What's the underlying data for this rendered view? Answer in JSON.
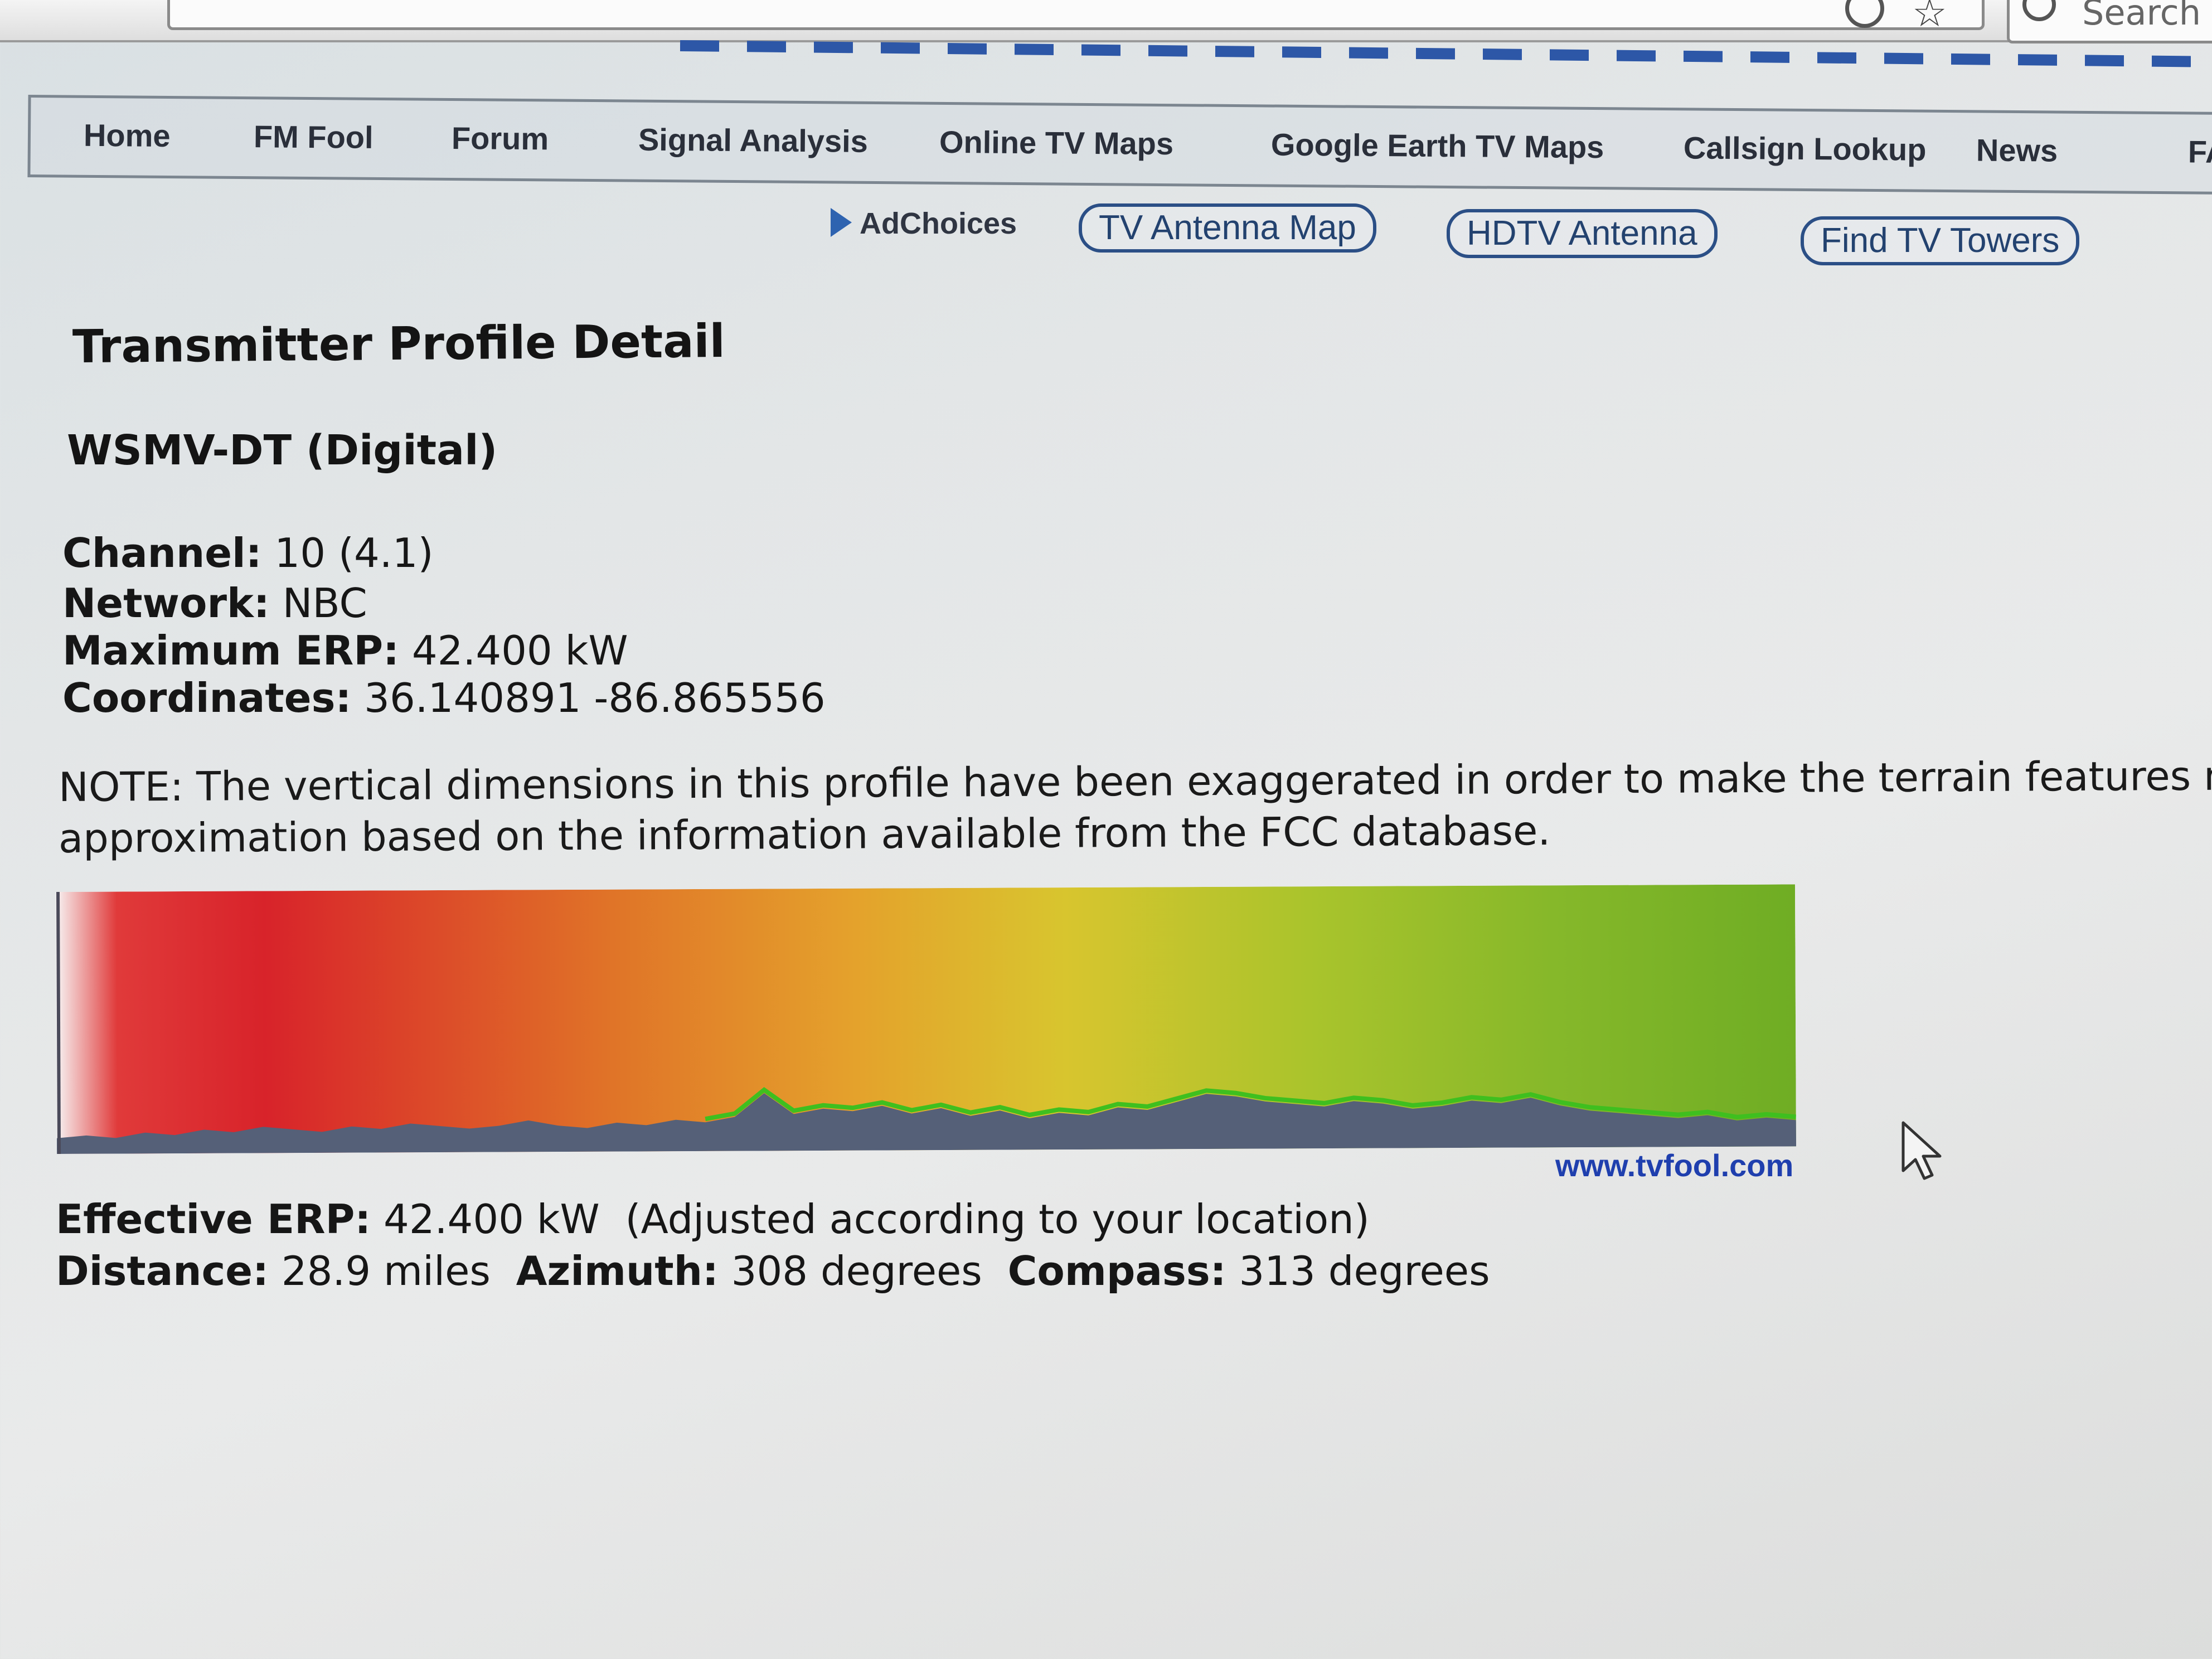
{
  "browser": {
    "search_placeholder": "Search"
  },
  "nav": {
    "items": [
      {
        "label": "Home"
      },
      {
        "label": "FM Fool"
      },
      {
        "label": "Forum"
      },
      {
        "label": "Signal Analysis"
      },
      {
        "label": "Online TV Maps"
      },
      {
        "label": "Google Earth TV Maps"
      },
      {
        "label": "Callsign Lookup"
      },
      {
        "label": "News"
      },
      {
        "label": "FA"
      }
    ]
  },
  "ads": {
    "adchoices": "AdChoices",
    "links": [
      {
        "label": "TV Antenna Map"
      },
      {
        "label": "HDTV Antenna"
      },
      {
        "label": "Find TV Towers"
      }
    ]
  },
  "page": {
    "title": "Transmitter Profile Detail",
    "station": "WSMV-DT (Digital)",
    "channel_label": "Channel:",
    "channel_value": "10 (4.1)",
    "network_label": "Network:",
    "network_value": "NBC",
    "max_erp_label": "Maximum ERP:",
    "max_erp_value": "42.400 kW",
    "coordinates_label": "Coordinates:",
    "coordinates_value": "36.140891 -86.865556",
    "note_line1": "NOTE: The vertical dimensions in this profile have been exaggerated in order to make the terrain features m",
    "note_line2": "approximation based on the information available from the FCC database.",
    "tvfool_link": "www.tvfool.com",
    "effective_erp_label": "Effective ERP:",
    "effective_erp_value": "42.400 kW",
    "effective_erp_note": "(Adjusted according to your location)",
    "distance_label": "Distance:",
    "distance_value": "28.9 miles",
    "azimuth_label": "Azimuth:",
    "azimuth_value": "308 degrees",
    "compass_label": "Compass:",
    "compass_value": "313 degrees"
  },
  "colors": {
    "nav_text": "#2a2f3a",
    "link_blue": "#1f3fae",
    "terrain": "#556078",
    "signal_green_edge": "#3fbf1f"
  },
  "terrain_profile": [
    0.06,
    0.07,
    0.06,
    0.08,
    0.07,
    0.09,
    0.08,
    0.1,
    0.09,
    0.08,
    0.1,
    0.09,
    0.11,
    0.1,
    0.09,
    0.1,
    0.12,
    0.1,
    0.09,
    0.11,
    0.1,
    0.12,
    0.11,
    0.13,
    0.22,
    0.14,
    0.16,
    0.15,
    0.17,
    0.14,
    0.16,
    0.13,
    0.15,
    0.12,
    0.14,
    0.13,
    0.16,
    0.15,
    0.18,
    0.21,
    0.2,
    0.18,
    0.17,
    0.16,
    0.18,
    0.17,
    0.15,
    0.16,
    0.18,
    0.17,
    0.19,
    0.16,
    0.14,
    0.13,
    0.12,
    0.11,
    0.12,
    0.1,
    0.11,
    0.1
  ]
}
